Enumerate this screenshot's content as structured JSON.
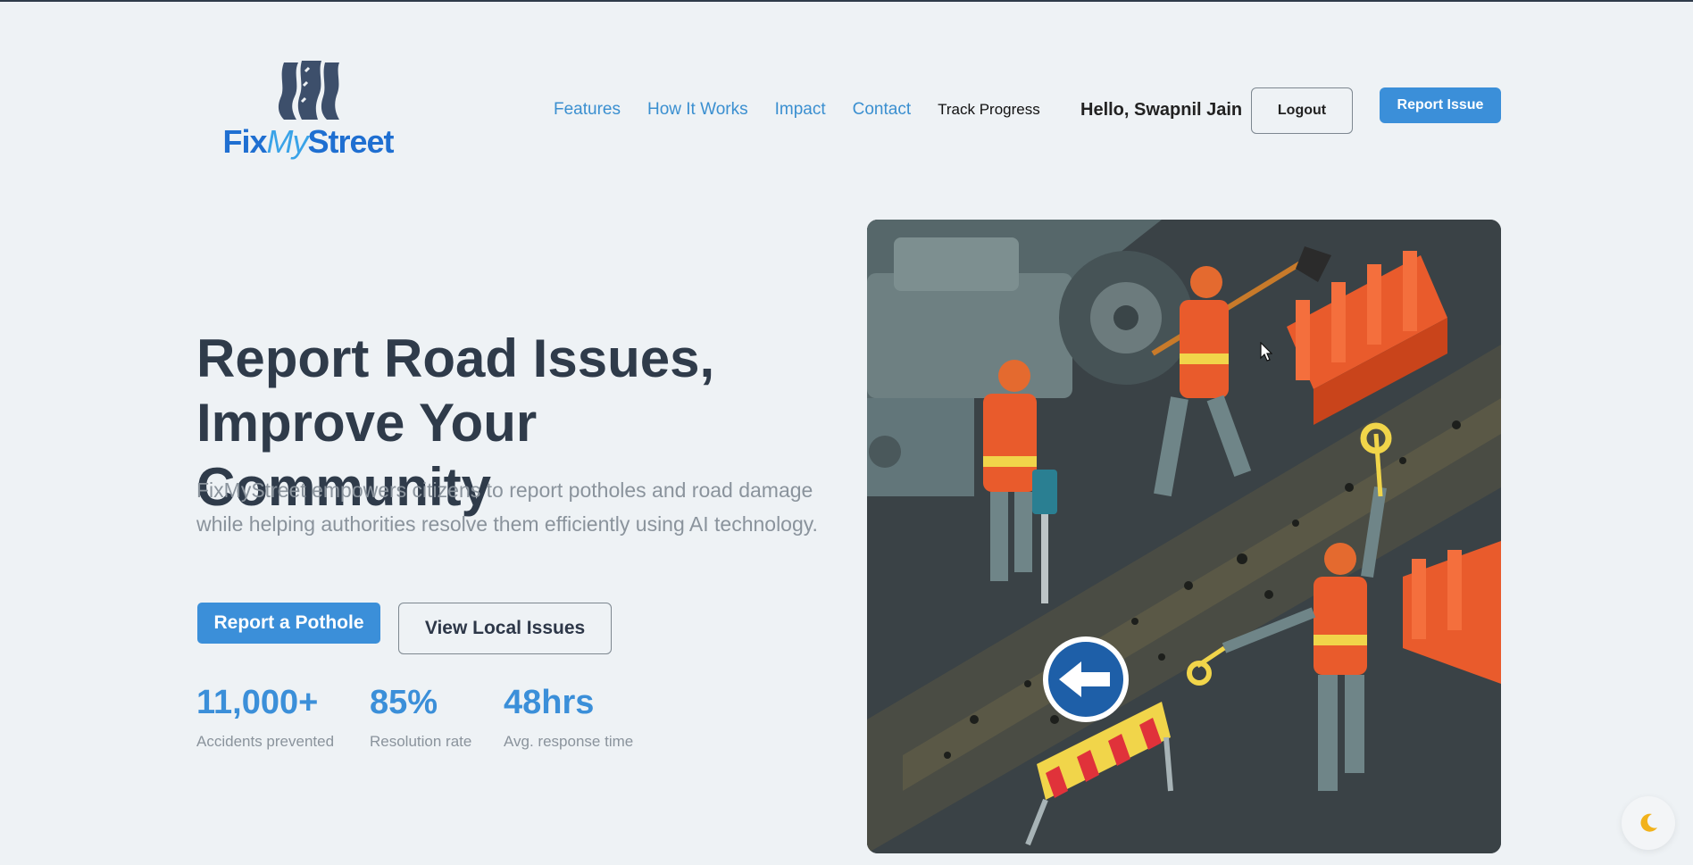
{
  "brand": {
    "name_part1": "Fix",
    "name_part2": "My",
    "name_part3": "Street"
  },
  "nav": {
    "links": [
      "Features",
      "How It Works",
      "Impact",
      "Contact"
    ],
    "track_progress": "Track Progress"
  },
  "user": {
    "greeting": "Hello, Swapnil Jain"
  },
  "header_buttons": {
    "logout": "Logout",
    "report_issue": "Report Issue"
  },
  "hero": {
    "title_line1": "Report Road Issues,",
    "title_line2": "Improve Your Community",
    "description": "FixMyStreet empowers citizens to report potholes and road damage while helping authorities resolve them efficiently using AI technology.",
    "primary_cta": "Report a Pothole",
    "secondary_cta": "View Local Issues"
  },
  "stats": [
    {
      "value": "11,000+",
      "label": "Accidents prevented"
    },
    {
      "value": "85%",
      "label": "Resolution rate"
    },
    {
      "value": "48hrs",
      "label": "Avg. response time"
    }
  ],
  "colors": {
    "accent": "#3b8fd9",
    "heading": "#2f3b4a",
    "muted": "#8a939c",
    "background": "#eef2f5"
  },
  "icons": {
    "theme_toggle": "moon-icon",
    "cursor": "mouse-cursor-icon"
  }
}
